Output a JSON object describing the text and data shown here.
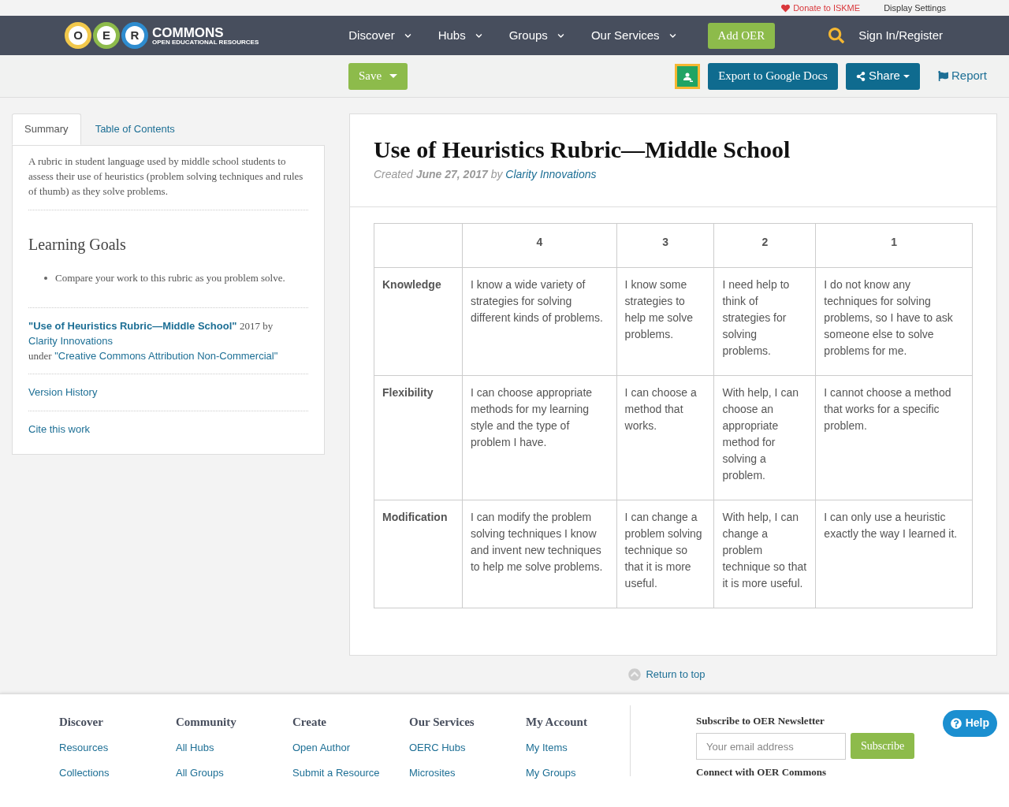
{
  "top_bar": {
    "donate": "Donate to ISKME",
    "display_settings": "Display Settings"
  },
  "nav": {
    "logo": {
      "letters": [
        {
          "text": "O",
          "color": "#f2c84b"
        },
        {
          "text": "E",
          "color": "#8dbb4b"
        },
        {
          "text": "R",
          "color": "#2e8ccf"
        }
      ],
      "name": "COMMONS",
      "tagline": "OPEN EDUCATIONAL RESOURCES"
    },
    "menu": [
      "Discover",
      "Hubs",
      "Groups",
      "Our Services"
    ],
    "add_button": "Add OER",
    "sign_in": "Sign In/Register"
  },
  "toolbar": {
    "save": "Save",
    "export": "Export to Google Docs",
    "share": "Share",
    "report": "Report"
  },
  "sidebar": {
    "tabs": [
      {
        "label": "Summary",
        "selected": true
      },
      {
        "label": "Table of Contents",
        "selected": false
      }
    ],
    "description": "A rubric in student language used by middle school students to assess their use of heuristics (problem solving techniques and rules of thumb) as they solve problems.",
    "learning_goals": {
      "title": "Learning Goals",
      "items": [
        "Compare your work to this rubric as you problem solve."
      ]
    },
    "attribution": {
      "title": "\"Use of Heuristics Rubric—Middle School\"",
      "year_by": "2017 by",
      "author": "Clarity Innovations",
      "under": "under",
      "license": "\"Creative Commons Attribution Non-Commercial\""
    },
    "links": [
      "Version History",
      "Cite this work"
    ]
  },
  "resource": {
    "title": "Use of Heuristics Rubric—Middle School",
    "created_label": "Created",
    "date": "June 27, 2017",
    "by_label": "by",
    "author": "Clarity Innovations"
  },
  "rubric": {
    "columns": [
      "4",
      "3",
      "2",
      "1"
    ],
    "rows": [
      {
        "label": "Knowledge",
        "cells": [
          "I know a wide variety of strategies for solving different kinds of problems.",
          "I know some strategies to help me solve problems.",
          "I need help to think of strategies for solving problems.",
          "I do not know any techniques for solving problems, so I have to ask someone else to solve problems for me."
        ]
      },
      {
        "label": "Flexibility",
        "cells": [
          "I can choose appropriate methods for my learning style and the type of problem I have.",
          "I can choose a method that works.",
          "With help, I can choose an appropriate method for solving a problem.",
          "I cannot choose a method that works for a specific problem."
        ]
      },
      {
        "label": "Modification",
        "cells": [
          "I can modify the problem solving techniques I know and invent new techniques to help me solve problems.",
          "I can change a problem solving technique so that it is more useful.",
          "With help, I can change a problem technique so that it is more useful.",
          "I can only use a heuristic exactly the way I learned it."
        ]
      }
    ]
  },
  "return_to_top": "Return to top",
  "footer": {
    "columns": [
      {
        "title": "Discover",
        "links": [
          "Resources",
          "Collections"
        ]
      },
      {
        "title": "Community",
        "links": [
          "All Hubs",
          "All Groups"
        ]
      },
      {
        "title": "Create",
        "links": [
          "Open Author",
          "Submit a Resource"
        ]
      },
      {
        "title": "Our Services",
        "links": [
          "OERC Hubs",
          "Microsites"
        ]
      },
      {
        "title": "My Account",
        "links": [
          "My Items",
          "My Groups"
        ]
      }
    ],
    "newsletter": {
      "title": "Subscribe to OER Newsletter",
      "placeholder": "Your email address",
      "button": "Subscribe"
    },
    "connect_title": "Connect with OER Commons",
    "help": "Help"
  }
}
